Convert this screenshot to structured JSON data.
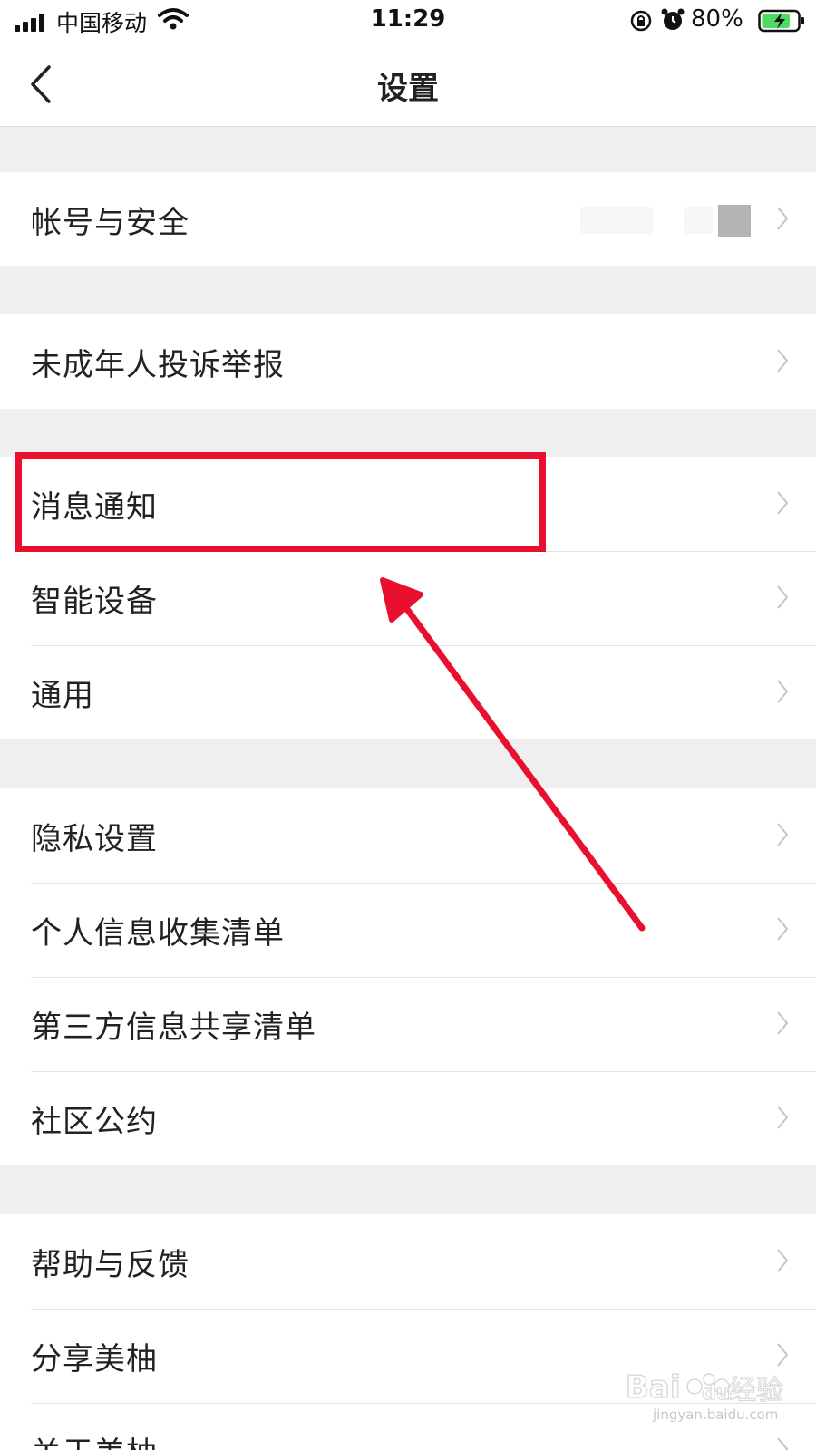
{
  "status_bar": {
    "carrier": "中国移动",
    "time": "11:29",
    "battery_percent": "80%",
    "battery_level": 0.8,
    "battery_color": "#4cd964",
    "icons": [
      "signal-icon",
      "wifi-icon",
      "rotation-lock-icon",
      "alarm-icon",
      "battery-charging-icon"
    ]
  },
  "nav": {
    "title": "设置",
    "back_icon": "chevron-left-icon"
  },
  "groups": [
    {
      "items": [
        {
          "label": "帐号与安全"
        }
      ]
    },
    {
      "items": [
        {
          "label": "未成年人投诉举报"
        }
      ]
    },
    {
      "items": [
        {
          "label": "消息通知"
        },
        {
          "label": "智能设备"
        },
        {
          "label": "通用"
        }
      ]
    },
    {
      "items": [
        {
          "label": "隐私设置"
        },
        {
          "label": "个人信息收集清单"
        },
        {
          "label": "第三方信息共享清单"
        },
        {
          "label": "社区公约"
        }
      ]
    },
    {
      "items": [
        {
          "label": "帮助与反馈"
        },
        {
          "label": "分享美柚"
        },
        {
          "label": "关于美柚"
        }
      ]
    }
  ],
  "annotation": {
    "highlighted_item": "消息通知",
    "color": "#e8102e"
  },
  "watermark": {
    "logo": "Baidu经验",
    "url": "jingyan.baidu.com"
  }
}
